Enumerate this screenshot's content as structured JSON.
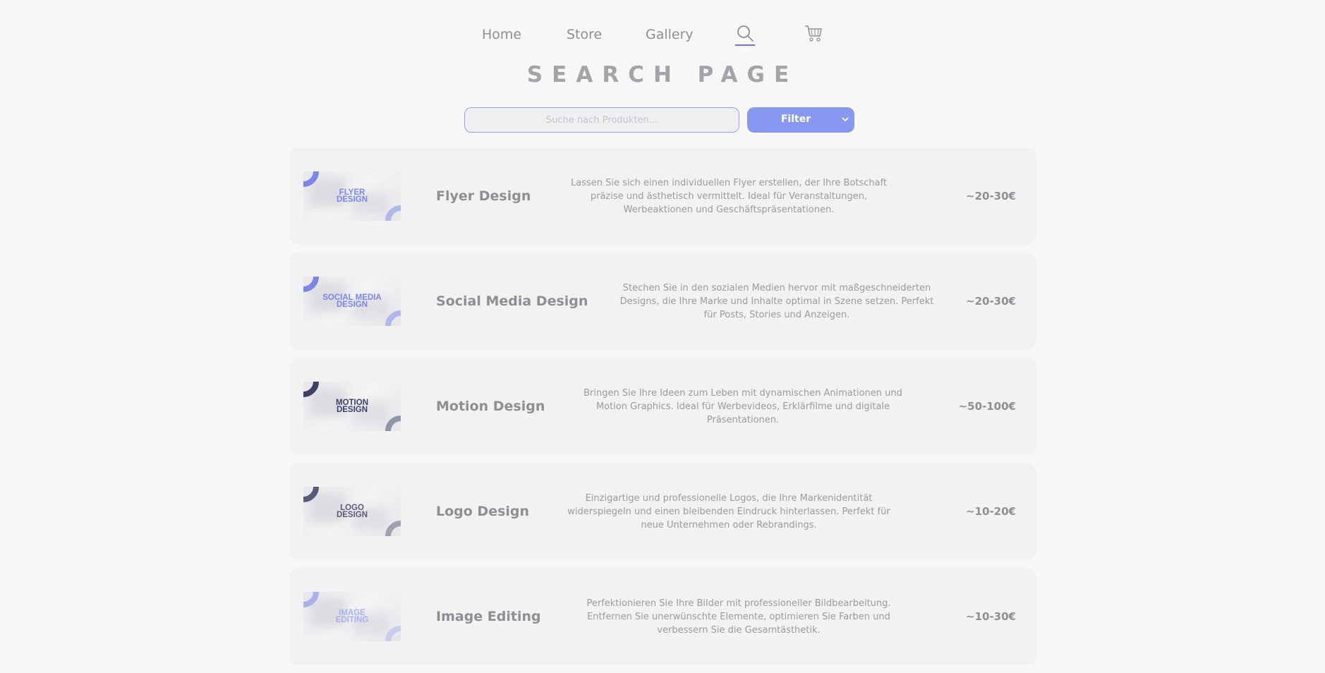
{
  "nav": {
    "home_label": "Home",
    "store_label": "Store",
    "gallery_label": "Gallery",
    "search_icon": "search-icon",
    "cart_icon": "cart-icon"
  },
  "page": {
    "title": "SEARCH PAGE"
  },
  "search": {
    "placeholder": "Suche nach Produkten...",
    "value": ""
  },
  "filter": {
    "selected": "Filter"
  },
  "colors": {
    "accent": "#8898f0",
    "underline": "#6a74e8",
    "flyer": "#7b86e8",
    "social": "#7b86e8",
    "motion": "#3c3f66",
    "logo": "#5a5a78",
    "image": "#a9b0ee"
  },
  "products": [
    {
      "thumb_lines": [
        "FLYER",
        "DESIGN"
      ],
      "title": "Flyer Design",
      "description": "Lassen Sie sich einen individuellen Flyer erstellen, der Ihre Botschaft präzise und ästhetisch vermittelt. Ideal für Veranstaltungen, Werbeaktionen und Geschäftspräsentationen.",
      "price": "~20-30€"
    },
    {
      "thumb_lines": [
        "SOCIAL MEDIA",
        "DESIGN"
      ],
      "title": "Social Media Design",
      "description": "Stechen Sie in den sozialen Medien hervor mit maßgeschneiderten Designs, die Ihre Marke und Inhalte optimal in Szene setzen. Perfekt für Posts, Stories und Anzeigen.",
      "price": "~20-30€"
    },
    {
      "thumb_lines": [
        "MOTION",
        "DESIGN"
      ],
      "title": "Motion Design",
      "description": "Bringen Sie Ihre Ideen zum Leben mit dynamischen Animationen und Motion Graphics. Ideal für Werbevideos, Erklärfilme und digitale Präsentationen.",
      "price": "~50-100€"
    },
    {
      "thumb_lines": [
        "LOGO",
        "DESIGN"
      ],
      "title": "Logo Design",
      "description": "Einzigartige und professionelle Logos, die Ihre Markenidentität widerspiegeln und einen bleibenden Eindruck hinterlassen. Perfekt für neue Unternehmen oder Rebrandings.",
      "price": "~10-20€"
    },
    {
      "thumb_lines": [
        "IMAGE",
        "EDITING"
      ],
      "title": "Image Editing",
      "description": "Perfektionieren Sie Ihre Bilder mit professioneller Bildbearbeitung. Entfernen Sie unerwünschte Elemente, optimieren Sie Farben und verbessern Sie die Gesamtästhetik.",
      "price": "~10-30€"
    }
  ]
}
